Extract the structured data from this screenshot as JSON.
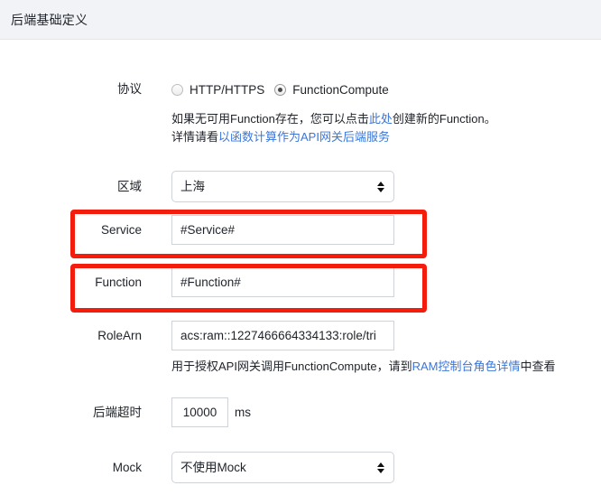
{
  "header": {
    "title": "后端基础定义"
  },
  "form": {
    "protocol": {
      "label": "协议",
      "options": [
        {
          "label": "HTTP/HTTPS",
          "selected": false
        },
        {
          "label": "FunctionCompute",
          "selected": true
        }
      ],
      "help": {
        "line1_pre": "如果无可用Function存在，您可以点击",
        "line1_link": "此处",
        "line1_post": "创建新的Function。",
        "line2_pre": "详情请看",
        "line2_link": "以函数计算作为API网关后端服务"
      }
    },
    "region": {
      "label": "区域",
      "value": "上海",
      "control": "select"
    },
    "service": {
      "label": "Service",
      "value": "#Service#",
      "control": "text",
      "highlighted": true
    },
    "function": {
      "label": "Function",
      "value": "#Function#",
      "control": "text",
      "highlighted": true
    },
    "rolearn": {
      "label": "RoleArn",
      "value": "acs:ram::1227466664334133:role/tri",
      "control": "text",
      "help_pre": "用于授权API网关调用FunctionCompute，请到",
      "help_link": "RAM控制台角色详情",
      "help_post": "中查看"
    },
    "timeout": {
      "label": "后端超时",
      "value": "10000",
      "unit": "ms",
      "control": "text"
    },
    "mock": {
      "label": "Mock",
      "value": "不使用Mock",
      "control": "select"
    }
  },
  "colors": {
    "annotation": "#f41c0d",
    "link": "#3b76d8",
    "header_bg": "#f1f3f7",
    "input_border": "#cfd2d6"
  }
}
